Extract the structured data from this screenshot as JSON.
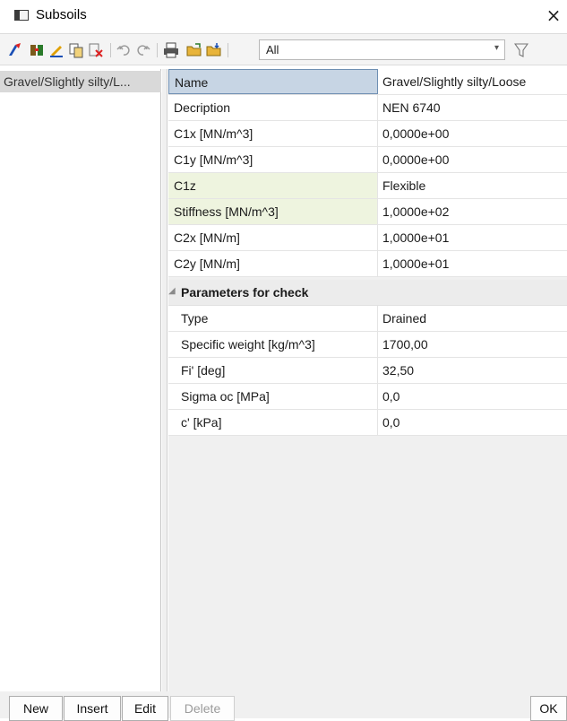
{
  "window": {
    "title": "Subsoils",
    "close_glyph": "×"
  },
  "toolbar": {
    "filter_value": "All",
    "icons": [
      "new-subsoil-icon",
      "import-icon",
      "edit-icon",
      "copy-icon",
      "delete-icon",
      "undo-icon",
      "redo-icon",
      "print-icon",
      "open-folder-icon",
      "save-folder-icon",
      "filter-funnel-icon"
    ]
  },
  "list": {
    "items": [
      "Gravel/Slightly silty/L..."
    ]
  },
  "properties": [
    {
      "key": "Name",
      "value": "Gravel/Slightly silty/Loose"
    },
    {
      "key": "Decription",
      "value": "NEN 6740"
    },
    {
      "key": "C1x [MN/m^3]",
      "value": "0,0000e+00"
    },
    {
      "key": "C1y [MN/m^3]",
      "value": "0,0000e+00"
    },
    {
      "key": "C1z",
      "value": "Flexible"
    },
    {
      "key": "Stiffness [MN/m^3]",
      "value": "1,0000e+02"
    },
    {
      "key": "C2x [MN/m]",
      "value": "1,0000e+01"
    },
    {
      "key": "C2y [MN/m]",
      "value": "1,0000e+01"
    }
  ],
  "check_group": {
    "title": "Parameters for check",
    "rows": [
      {
        "key": "Type",
        "value": "Drained"
      },
      {
        "key": "Specific weight [kg/m^3]",
        "value": "1700,00"
      },
      {
        "key": "Fi' [deg]",
        "value": "32,50"
      },
      {
        "key": "Sigma oc [MPa]",
        "value": "0,0"
      },
      {
        "key": "c' [kPa]",
        "value": "0,0"
      }
    ]
  },
  "buttons": {
    "new": "New",
    "insert": "Insert",
    "edit": "Edit",
    "delete": "Delete",
    "ok": "OK"
  }
}
